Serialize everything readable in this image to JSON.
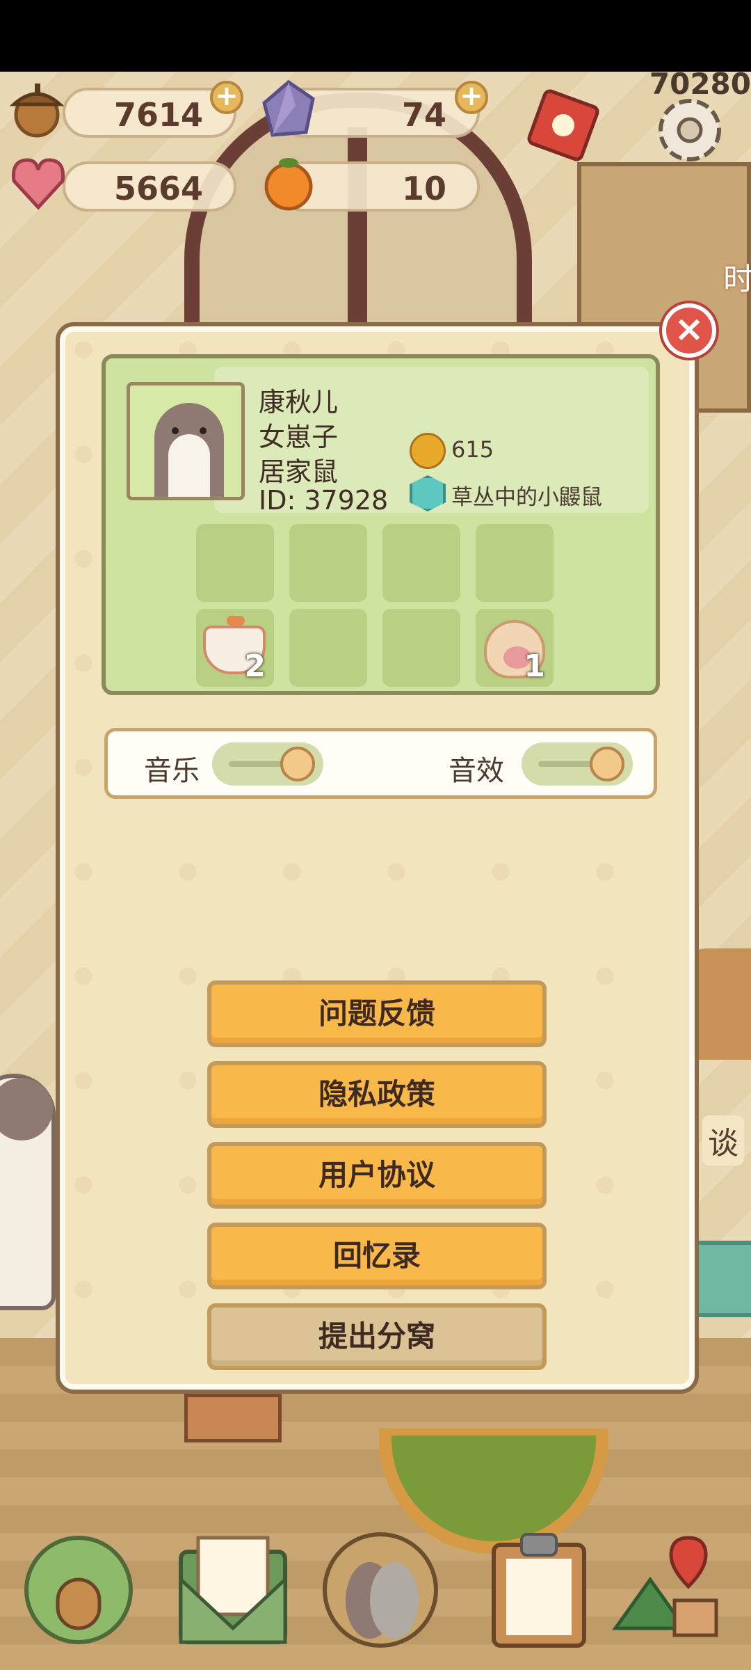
{
  "currency": {
    "acorns": "7614",
    "crystals": "74",
    "hearts": "5664",
    "oranges": "10",
    "top_right_counter": "70280"
  },
  "profile": {
    "name": "康秋儿",
    "title": "女崽子",
    "role": "居家鼠",
    "id_label": "ID: 37928",
    "bells": "615",
    "badge_title": "草丛中的小鼹鼠",
    "slots": [
      {
        "item": "",
        "count": ""
      },
      {
        "item": "",
        "count": ""
      },
      {
        "item": "",
        "count": ""
      },
      {
        "item": "",
        "count": ""
      },
      {
        "item": "pot-icon",
        "count": "2"
      },
      {
        "item": "",
        "count": ""
      },
      {
        "item": "",
        "count": ""
      },
      {
        "item": "paw-icon",
        "count": "1"
      }
    ]
  },
  "settings": {
    "music_label": "音乐",
    "sfx_label": "音效",
    "music_on": true,
    "sfx_on": true
  },
  "menu": {
    "feedback": "问题反馈",
    "privacy": "隐私政策",
    "agreement": "用户协议",
    "memoir": "回忆录",
    "leave": "提出分窝"
  },
  "side_text": {
    "right_edge_1": "时",
    "right_edge_2": "谈"
  },
  "icons": {
    "close": "close-icon",
    "settings": "gear-icon",
    "nav": [
      "house-icon",
      "mail-icon",
      "avatar-friends-icon",
      "clipboard-icon",
      "map-icon"
    ]
  },
  "colors": {
    "button": "#f9b94a",
    "button_muted": "#dcc396",
    "card": "#cfe3a0",
    "close": "#e0544a"
  }
}
